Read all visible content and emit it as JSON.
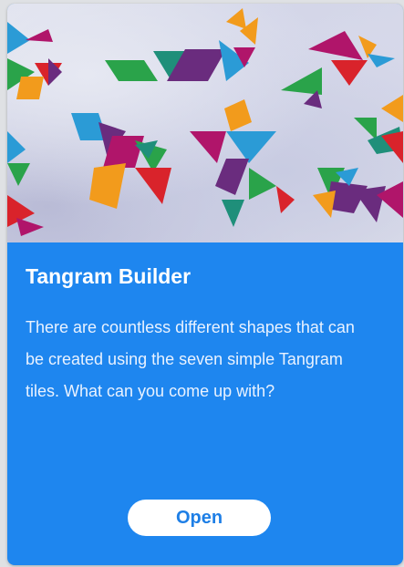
{
  "card": {
    "title": "Tangram Builder",
    "description": "There are countless different shapes that can be created using the seven simple Tangram tiles. What can you come up with?",
    "open_label": "Open"
  },
  "colors": {
    "card_blue": "#1e86ef",
    "button_text": "#1e7fe6",
    "tangram_palette": [
      "#f29b1c",
      "#2b9bd6",
      "#6a2c7e",
      "#b0156a",
      "#2aa34a",
      "#d9232b",
      "#1f8f7a"
    ]
  }
}
